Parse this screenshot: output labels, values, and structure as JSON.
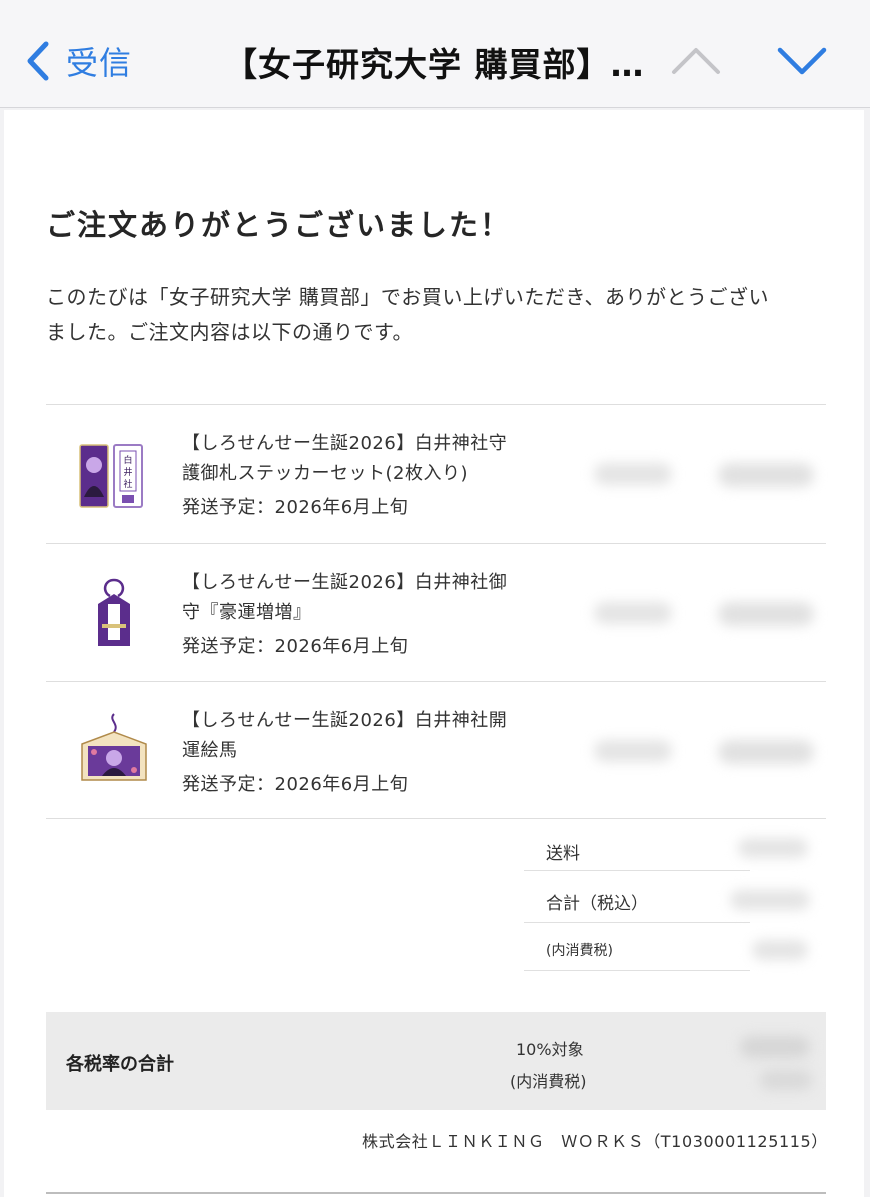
{
  "nav": {
    "back_label": "受信",
    "title": "【女子研究大学 購買部】…"
  },
  "email": {
    "heading": "ご注文ありがとうございました！",
    "intro_line1": "このたびは「女子研究大学 購買部」でお買い上げいただき、ありがとうござい",
    "intro_line2": "ました。ご注文内容は以下の通りです。"
  },
  "items": [
    {
      "title_line1": "【しろせんせー生誕2026】白井神社守",
      "title_line2": "護御札ステッカーセット(2枚入り)",
      "shipping": "発送予定：2026年6月上旬",
      "thumb_icon": "sticker-set-thumbnail"
    },
    {
      "title_line1": "【しろせんせー生誕2026】白井神社御",
      "title_line2": "守『豪運増増』",
      "shipping": "発送予定：2026年6月上旬",
      "thumb_icon": "omamori-thumbnail"
    },
    {
      "title_line1": "【しろせんせー生誕2026】白井神社開",
      "title_line2": "運絵馬",
      "shipping": "発送予定：2026年6月上旬",
      "thumb_icon": "ema-thumbnail"
    }
  ],
  "summary": {
    "shipping_label": "送料",
    "total_label": "合計（税込）",
    "tax_included_label": "(内消費税)"
  },
  "tax_box": {
    "label": "各税率の合計",
    "rate": "10%対象",
    "note": "(内消費税)"
  },
  "company": "株式会社ＬＩＮＫＩＮＧ　ＷＯＲＫＳ（T1030001125115）",
  "colors": {
    "accent": "#2f7de1",
    "purple": "#6a3a9a"
  }
}
